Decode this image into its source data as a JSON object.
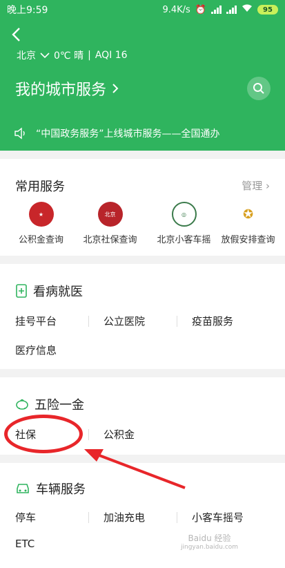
{
  "statusbar": {
    "time": "晚上9:59",
    "speed": "9.4K/s",
    "battery": "95"
  },
  "header": {
    "city": "北京",
    "weather": "0℃ 晴",
    "aqi": "AQI 16",
    "title": "我的城市服务",
    "notice": "“中国政务服务”上线城市服务——全国通办"
  },
  "common": {
    "title": "常用服务",
    "manage": "管理",
    "items": [
      {
        "label": "公积金查询",
        "icon": "gov-badge-icon",
        "color": "#c8262a"
      },
      {
        "label": "北京社保查询",
        "icon": "beijing-social-icon",
        "color": "#b8242a"
      },
      {
        "label": "北京小客车摇",
        "icon": "car-lottery-seal-icon",
        "color": "#3a7a4a"
      },
      {
        "label": "放假安排查询",
        "icon": "national-emblem-icon",
        "color": "#d8a020"
      }
    ]
  },
  "medical": {
    "title": "看病就医",
    "items": [
      "挂号平台",
      "公立医院",
      "疫苗服务",
      "医疗信息"
    ]
  },
  "insurance": {
    "title": "五险一金",
    "items": [
      "社保",
      "公积金"
    ]
  },
  "vehicle": {
    "title": "车辆服务",
    "items": [
      "停车",
      "加油充电",
      "小客车摇号",
      "ETC"
    ]
  },
  "watermark": {
    "line1": "Baidu 经验",
    "line2": "jingyan.baidu.com"
  }
}
